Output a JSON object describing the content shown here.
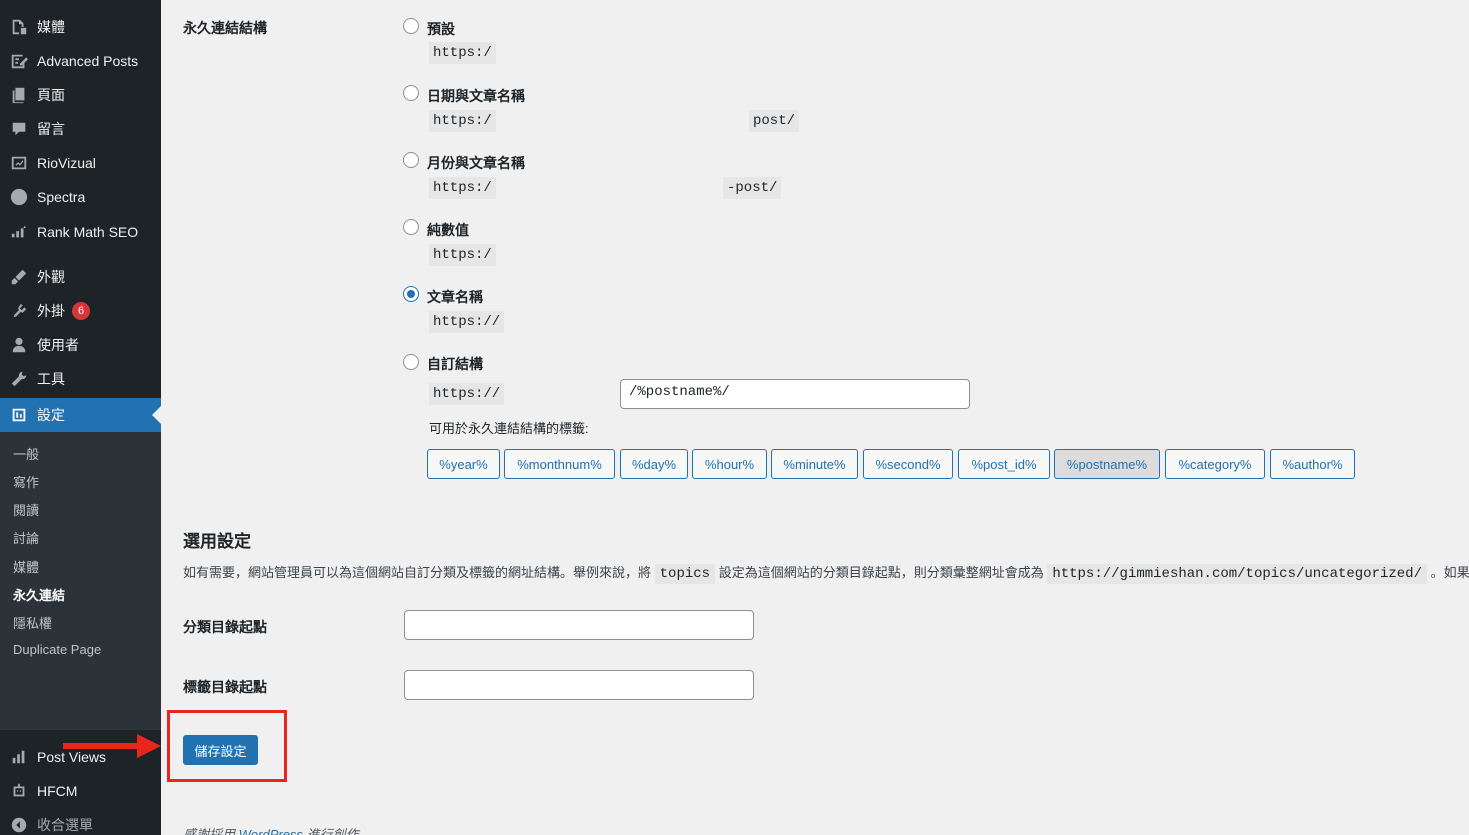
{
  "sidebar": {
    "menu": [
      {
        "label": "媒體",
        "icon": "media-icon"
      },
      {
        "label": "Advanced Posts",
        "icon": "advanced-posts-icon"
      },
      {
        "label": "頁面",
        "icon": "page-icon"
      },
      {
        "label": "留言",
        "icon": "comment-icon"
      },
      {
        "label": "RioVizual",
        "icon": "chart-icon"
      },
      {
        "label": "Spectra",
        "icon": "spectra-icon"
      },
      {
        "label": "Rank Math SEO",
        "icon": "rank-math-icon"
      },
      {
        "label": "外觀",
        "icon": "brush-icon"
      },
      {
        "label": "外掛",
        "icon": "plugin-icon",
        "badge": "6"
      },
      {
        "label": "使用者",
        "icon": "user-icon"
      },
      {
        "label": "工具",
        "icon": "wrench-icon"
      },
      {
        "label": "設定",
        "icon": "settings-icon"
      }
    ],
    "submenu": [
      "一般",
      "寫作",
      "閱讀",
      "討論",
      "媒體",
      "永久連結",
      "隱私權",
      "Duplicate Page"
    ],
    "bottom": [
      {
        "label": "Post Views",
        "icon": "bar-chart-icon"
      },
      {
        "label": "HFCM",
        "icon": "robot-icon"
      },
      {
        "label": "收合選單",
        "icon": "collapse-icon"
      }
    ]
  },
  "permalink": {
    "label": "永久連結結構",
    "options": [
      {
        "label": "預設",
        "example_start": "https:/",
        "example_end": ""
      },
      {
        "label": "日期與文章名稱",
        "example_start": "https:/",
        "example_end": "post/"
      },
      {
        "label": "月份與文章名稱",
        "example_start": "https:/",
        "example_end": "-post/"
      },
      {
        "label": "純數值",
        "example_start": "https:/",
        "example_end": ""
      },
      {
        "label": "文章名稱",
        "example_start": "https://",
        "example_end": ""
      },
      {
        "label": "自訂結構",
        "example_start": "https://",
        "example_end": ""
      }
    ],
    "selected": "文章名稱",
    "custom_value": "/%postname%/",
    "tags_label": "可用於永久連結結構的標籤:",
    "tags": [
      "%year%",
      "%monthnum%",
      "%day%",
      "%hour%",
      "%minute%",
      "%second%",
      "%post_id%",
      "%postname%",
      "%category%",
      "%author%"
    ],
    "pressed_tag": "%postname%"
  },
  "optional": {
    "title": "選用設定",
    "desc_1": "如有需要，網站管理員可以為這個網站自訂分類及標籤的網址結構。舉例來說，將",
    "desc_code_1": "topics",
    "desc_2": "設定為這個網站的分類目錄起點，則分類彙整網址會成為",
    "desc_code_2": "https://gimmieshan.com/topics/uncategorized/",
    "desc_3": "。如果在 [分",
    "category_base_label": "分類目錄起點",
    "category_base_value": "",
    "tag_base_label": "標籤目錄起點",
    "tag_base_value": ""
  },
  "save_label": "儲存設定",
  "footer": {
    "prefix": "感謝採用",
    "link": "WordPress",
    "suffix": "進行創作。"
  },
  "colors": {
    "sidebar": "#1d2327",
    "accent": "#2271b1",
    "highlight": "#e8261a"
  }
}
